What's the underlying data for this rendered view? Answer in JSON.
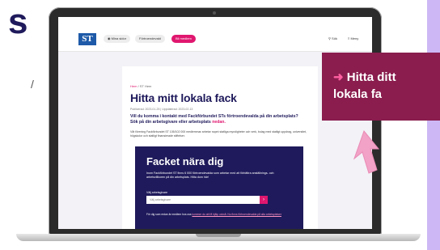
{
  "left_text": {
    "top": "s",
    "side": "/"
  },
  "header": {
    "logo_text": "ST",
    "nav": [
      "Mina sidor",
      "Förtroendevald",
      "Bli medlem"
    ],
    "search_label": "Sök",
    "menu_label": "Meny"
  },
  "article": {
    "breadcrumb_home": "Hem",
    "breadcrumb_sep": " / ",
    "breadcrumb_current": "ST Hem",
    "title": "Hitta mitt lokala fack",
    "published": "Publicerad: 2023-01-25  |  Uppdaterad: 2023-02-13",
    "intro_text": "Vill du komma i kontakt med Fackförbundet STs förtroendevalda på din arbetsplats? Sök på din arbetsgivare eller arbetsplats ",
    "intro_link": "nedan.",
    "body": "Vår förening Fackförbundet ST 105/102 000 medlemmar arbetar nopnt statliga myndigheter och verk, bolag med statligt uppdrag, universitet, högskolor och statligt finansierade stiftelser."
  },
  "finder": {
    "title": "Facket nära dig",
    "description": "Inom Fackförbundet ST finns 6 000 förtroendevalda som arbetar med att förbättra anställnings- och arbetsvillkoren på din arbetsplats. Hitta dom här!",
    "field_label": "Välj arbetsgivare",
    "select_placeholder": "Välj arbetsgivare",
    "select_button": "›",
    "footer_text": "För dig som redan är medlem hos oss ",
    "footer_link": "kommer du att få hjälp också. Nu finns förtroendevalda på alla arbetsplatser"
  },
  "callout": {
    "arrow": "➜",
    "text": "Hitta ditt\nlokala fa"
  },
  "colors": {
    "navy": "#1f1a5b",
    "pink": "#e0176f",
    "callout_bg": "#8a1d4e",
    "purple_strip": "#cdb8f5"
  }
}
